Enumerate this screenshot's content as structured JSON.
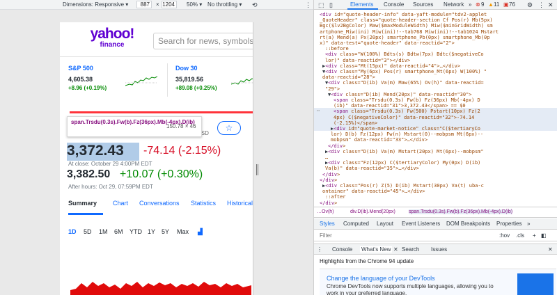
{
  "device_toolbar": {
    "dimensions_label": "Dimensions: Responsive ▾",
    "width": "887",
    "times": "×",
    "height": "1204",
    "zoom": "50% ▾",
    "throttle": "No throttling ▾"
  },
  "yahoo": {
    "logo_text": "yahoo!",
    "logo_sub": "finance",
    "search_placeholder": "Search for news, symbols or co",
    "tickers": [
      {
        "name": "S&P 500",
        "price": "4,605.38",
        "change": "+8.96 (+0.19%)"
      },
      {
        "name": "Dow 30",
        "price": "35,819.56",
        "change": "+89.08 (+0.25%)"
      }
    ],
    "tooltip_selector": "span.Trsdu(0.3s).Fw(b).Fz(36px).Mb(-4px).D(ib)",
    "tooltip_size": "150.78 × 46",
    "currency_suffix": "USD",
    "star_icon": "☆",
    "price": "3,372.43",
    "price_change": "-74.14 (-2.15%)",
    "close_note": "At close: October 29 4:00PM EDT",
    "after_hours_price": "3,382.50",
    "after_hours_change": "+10.07 (+0.30%)",
    "after_hours_note": "After hours: Oct 29, 07:59PM EDT",
    "tabs": [
      "Summary",
      "Chart",
      "Conversations",
      "Statistics",
      "Historical"
    ],
    "ranges": [
      "1D",
      "5D",
      "1M",
      "6M",
      "YTD",
      "1Y",
      "5Y",
      "Max"
    ],
    "colors": {
      "brand": "#6001d2",
      "link": "#0f69ff",
      "down": "#d60a22",
      "up": "#008a00"
    }
  },
  "devtools": {
    "tabs": [
      "Elements",
      "Console",
      "Sources",
      "Network"
    ],
    "more": "»",
    "errors": "9",
    "warnings": "11",
    "issues": "76",
    "code_lines": [
      "<div id=\"quote-header-info\" data-yaft-module=\"tdv2-applet",
      "_QuoteHeader\" class=\"quote-header-section Cf Pos(r) Mb(5px)",
      "Bgc($lv2BgColor) Maw($maxModuleWidth) Miw($minGridWidth) sm",
      "artphone_Miw(ini) Miw(ini)!--tab768 Miw(ini)!--tab1024 Mstart",
      "rt(a) Mend(a) Px(20px) smartphone_Pb(0px) smartphone_Mb(0p",
      "x)\" data-test=\"quote-header\" data-reactid=\"2\">",
      "::before",
      "<div class=\"W(100%) Bdts(s) Bdtw(7px)  Bdtc($negativeCo",
      "lor)\" data-reactid=\"3\"></div>",
      "▶<div class=\"Mt(15px)\" data-reactid=\"4\">…</div>",
      "▼<div class=\"My(6px) Pos(r) smartphone_Mt(6px) W(100%) \"",
      "data-reactid=\"28\">",
      "▼<div class=\"D(ib) Va(m) Maw(65%) Ov(h)\" data-reactid=",
      "\"29\">",
      "▼<div class=\"D(ib) Mend(20px)\" data-reactid=\"30\">",
      "<span class=\"Trsdu(0.3s) Fw(b) Fz(36px) Mb(-4px) D",
      "(ib)\" data-reactid=\"31\">3,372.43</span> == $0",
      "<span class=\"Trsdu(0.3s) Fw(500) Pstart(10px) Fz(2",
      "4px) C($negativeColor)\" data-reactid=\"32\">-74.14",
      "(-2.15%)</span>",
      "▶<div id=\"quote-market-notice\" class=\"C($tertiaryCo",
      "lor) D(b) Fz(12px) Fw(n) Mstart(0)--mobpsm Mt(6px)--",
      "mobpsm\" data-reactid=\"33\">…</div>",
      "</div>",
      "▶<div class=\"D(ib) Va(m) Mstart(20px)  Mt(6px)--mobpsm\"",
      "…",
      "▶<div class=\"Fz(12px) C($tertiaryColor) My(0px) D(ib)",
      "Va(b)\" data-reactid=\"35\">…</div>",
      "</div>",
      "</div>",
      "▶<div class=\"Pos(r) Z(5) D(ib) Mstart(30px) Va(t) uba-c",
      "ontainer\" data-reactid=\"45\">…</div>",
      "::after",
      "</div>"
    ],
    "breadcrumbs": [
      "…Ov(h)",
      "div.D(ib).Mend(20px)",
      "span.Trsdu(0.3s).Fw(b).Fz(36px).Mb(-4px).D(ib)"
    ],
    "style_tabs": [
      "Styles",
      "Computed",
      "Layout",
      "Event Listeners",
      "DOM Breakpoints",
      "Properties",
      "»"
    ],
    "filter_placeholder": "Filter",
    "filter_hov": ":hov",
    "filter_cls": ".cls",
    "filter_add": "+",
    "drawer_tabs": [
      "Console",
      "What's New",
      "Search",
      "Issues"
    ],
    "highlights": "Highlights from the Chrome 94 update",
    "card_title": "Change the language of your DevTools",
    "card_body": "Chrome DevTools now supports multiple languages, allowing you to work in your preferred language."
  }
}
